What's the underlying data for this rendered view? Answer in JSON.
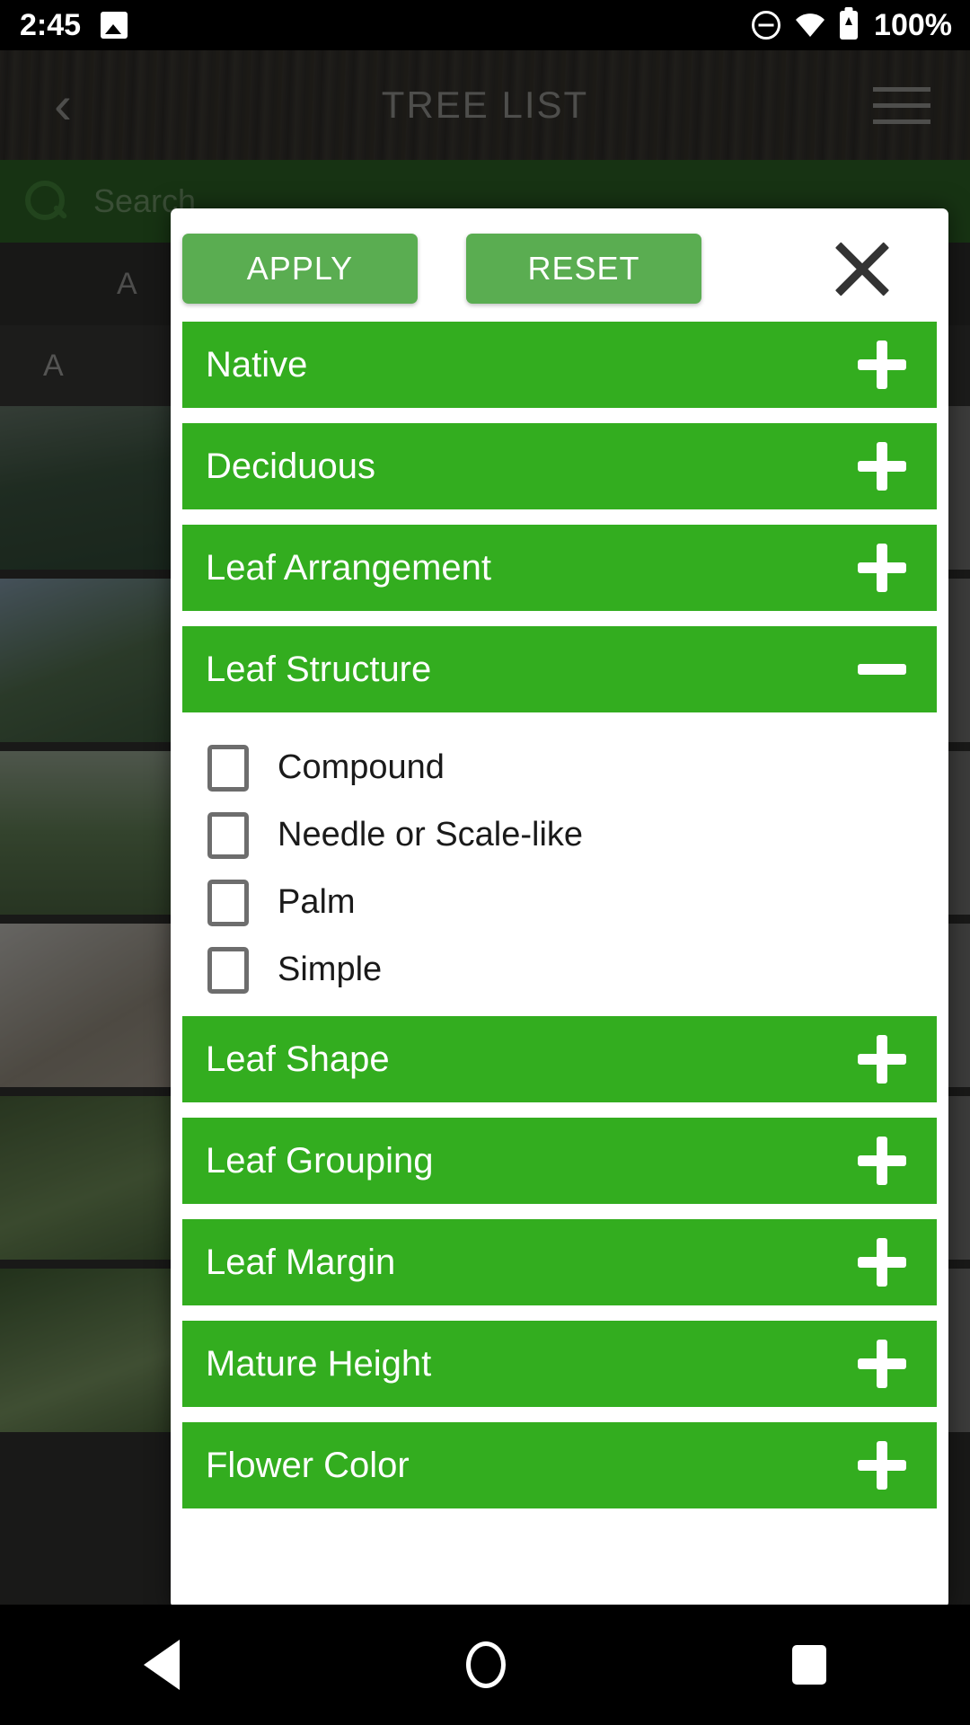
{
  "status_bar": {
    "time": "2:45",
    "battery_percent": "100%",
    "icons": [
      "image-icon",
      "do-not-disturb-icon",
      "wifi-icon",
      "battery-charging-icon"
    ]
  },
  "app": {
    "title": "TREE LIST",
    "back_icon": "‹",
    "menu_icon": "hamburger-menu-icon",
    "search": {
      "placeholder": "Search",
      "icon": "search-icon"
    },
    "alpha_index": "A B",
    "section_header": "A",
    "list_rows": [
      "thumb-a",
      "thumb-b",
      "thumb-c",
      "thumb-d",
      "thumb-e",
      "thumb-f"
    ]
  },
  "dialog": {
    "apply_label": "APPLY",
    "reset_label": "RESET",
    "close_icon": "close-icon",
    "filters": [
      {
        "label": "Native",
        "expanded": false,
        "sign": "+"
      },
      {
        "label": "Deciduous",
        "expanded": false,
        "sign": "+"
      },
      {
        "label": "Leaf Arrangement",
        "expanded": false,
        "sign": "+"
      },
      {
        "label": "Leaf Structure",
        "expanded": true,
        "sign": "−",
        "options": [
          {
            "label": "Compound",
            "checked": false
          },
          {
            "label": "Needle or Scale-like",
            "checked": false
          },
          {
            "label": "Palm",
            "checked": false
          },
          {
            "label": "Simple",
            "checked": false
          }
        ]
      },
      {
        "label": "Leaf Shape",
        "expanded": false,
        "sign": "+"
      },
      {
        "label": "Leaf Grouping",
        "expanded": false,
        "sign": "+"
      },
      {
        "label": "Leaf Margin",
        "expanded": false,
        "sign": "+"
      },
      {
        "label": "Mature Height",
        "expanded": false,
        "sign": "+"
      },
      {
        "label": "Flower Color",
        "expanded": false,
        "sign": "+"
      }
    ]
  },
  "nav_bar": {
    "back": "back-icon",
    "home": "home-icon",
    "recents": "recents-icon"
  },
  "colors": {
    "accordion_green": "#33ad1f",
    "button_green": "#5aad51",
    "search_green": "#2a5d23",
    "dialog_bg": "#ffffff",
    "close_icon": "#333333"
  }
}
